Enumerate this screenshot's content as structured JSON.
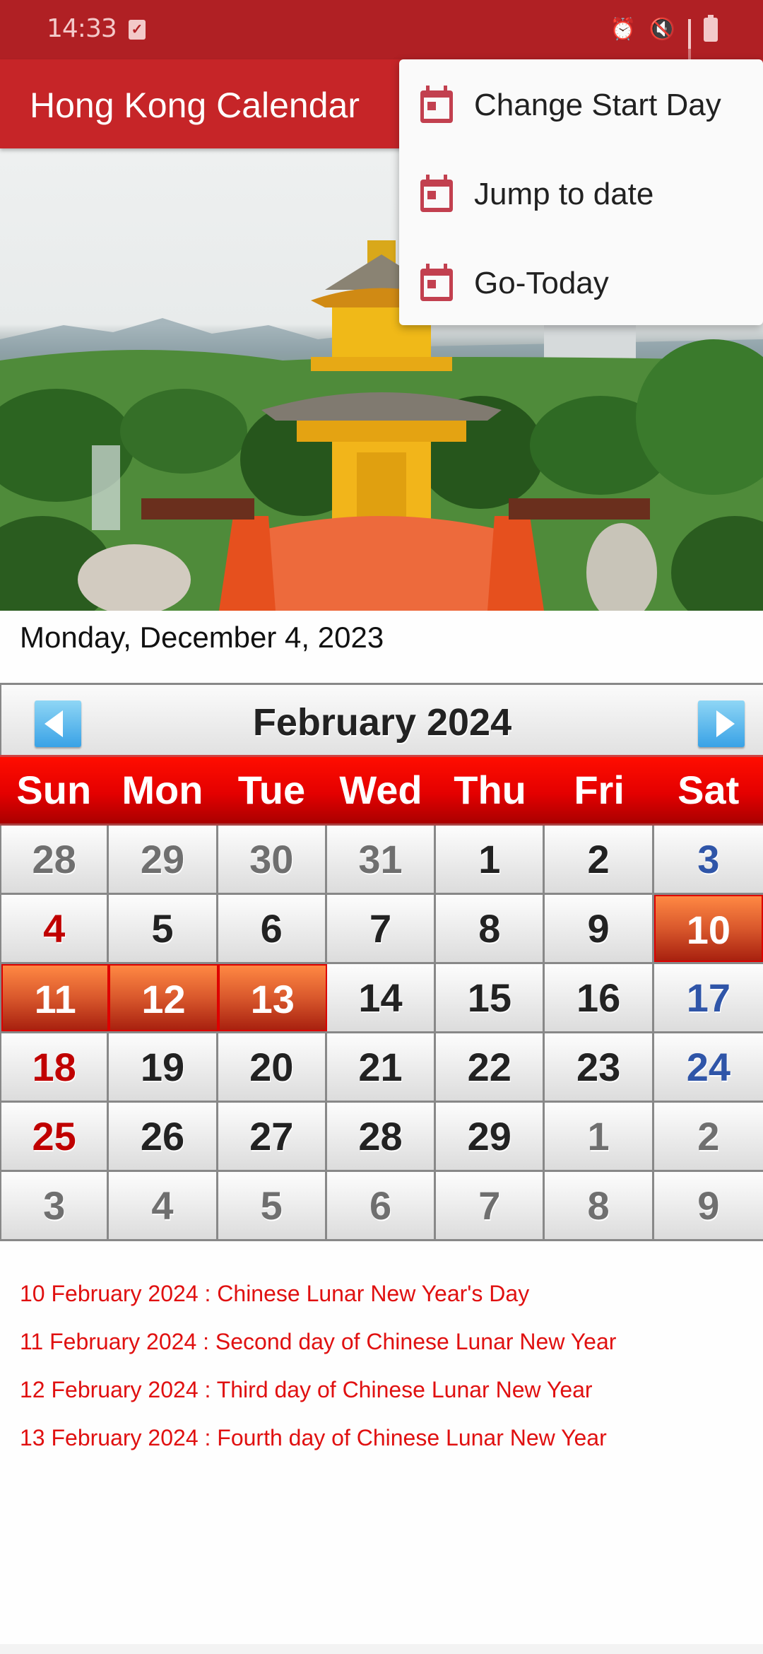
{
  "status_bar": {
    "time": "14:33",
    "notification_icon": "task-check-icon",
    "right_icons": [
      "alarm-icon",
      "vibrate-mute-icon",
      "signal-icon",
      "battery-icon"
    ]
  },
  "app_bar": {
    "title": "Hong Kong Calendar",
    "background_color": "#c62528"
  },
  "overflow_menu": {
    "items": [
      {
        "label": "Change Start Day",
        "icon": "calendar-icon"
      },
      {
        "label": "Jump to date",
        "icon": "calendar-icon"
      },
      {
        "label": "Go-Today",
        "icon": "calendar-icon"
      }
    ],
    "icon_color": "#c2404f"
  },
  "hero_image": {
    "description": "Golden pagoda with orange bridge in Nan Lian Garden, Hong Kong"
  },
  "today": "Monday, December 4, 2023",
  "calendar": {
    "month_title": "February  2024",
    "prev_label": "previous month",
    "next_label": "next month",
    "weekdays": [
      "Sun",
      "Mon",
      "Tue",
      "Wed",
      "Thu",
      "Fri",
      "Sat"
    ],
    "weeks": [
      [
        {
          "d": "28",
          "t": "other"
        },
        {
          "d": "29",
          "t": "other"
        },
        {
          "d": "30",
          "t": "other"
        },
        {
          "d": "31",
          "t": "other"
        },
        {
          "d": "1",
          "t": ""
        },
        {
          "d": "2",
          "t": ""
        },
        {
          "d": "3",
          "t": "sat"
        }
      ],
      [
        {
          "d": "4",
          "t": "sun"
        },
        {
          "d": "5",
          "t": ""
        },
        {
          "d": "6",
          "t": ""
        },
        {
          "d": "7",
          "t": ""
        },
        {
          "d": "8",
          "t": ""
        },
        {
          "d": "9",
          "t": ""
        },
        {
          "d": "10",
          "t": "holiday"
        }
      ],
      [
        {
          "d": "11",
          "t": "holiday"
        },
        {
          "d": "12",
          "t": "holiday"
        },
        {
          "d": "13",
          "t": "holiday"
        },
        {
          "d": "14",
          "t": ""
        },
        {
          "d": "15",
          "t": ""
        },
        {
          "d": "16",
          "t": ""
        },
        {
          "d": "17",
          "t": "sat"
        }
      ],
      [
        {
          "d": "18",
          "t": "sun"
        },
        {
          "d": "19",
          "t": ""
        },
        {
          "d": "20",
          "t": ""
        },
        {
          "d": "21",
          "t": ""
        },
        {
          "d": "22",
          "t": ""
        },
        {
          "d": "23",
          "t": ""
        },
        {
          "d": "24",
          "t": "sat"
        }
      ],
      [
        {
          "d": "25",
          "t": "sun"
        },
        {
          "d": "26",
          "t": ""
        },
        {
          "d": "27",
          "t": ""
        },
        {
          "d": "28",
          "t": ""
        },
        {
          "d": "29",
          "t": ""
        },
        {
          "d": "1",
          "t": "other"
        },
        {
          "d": "2",
          "t": "other"
        }
      ],
      [
        {
          "d": "3",
          "t": "other"
        },
        {
          "d": "4",
          "t": "other"
        },
        {
          "d": "5",
          "t": "other"
        },
        {
          "d": "6",
          "t": "other"
        },
        {
          "d": "7",
          "t": "other"
        },
        {
          "d": "8",
          "t": "other"
        },
        {
          "d": "9",
          "t": "other"
        }
      ]
    ],
    "colors": {
      "sunday": "#c00000",
      "saturday": "#2f55a8",
      "other_month": "#6f6f6f",
      "holiday_bg": "#d9582c",
      "weekday_header_bg": "#e40000"
    }
  },
  "holidays": [
    "10 February 2024 : Chinese Lunar New Year's Day",
    "11 February 2024 : Second day of Chinese Lunar New Year",
    "12 February 2024 : Third day of Chinese Lunar New Year",
    "13 February 2024 : Fourth day of Chinese Lunar New Year"
  ],
  "holiday_text_color": "#e01010"
}
